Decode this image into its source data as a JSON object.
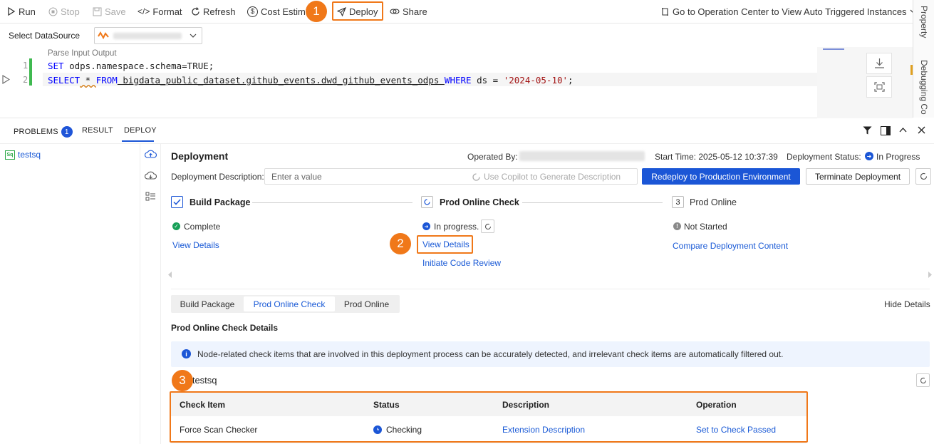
{
  "toolbar": {
    "run": "Run",
    "stop": "Stop",
    "save": "Save",
    "format": "Format",
    "refresh": "Refresh",
    "cost": "Cost Estima",
    "deploy": "Deploy",
    "share": "Share",
    "operation_center": "Go to Operation Center to View Auto Triggered Instances"
  },
  "callouts": {
    "one": "1",
    "two": "2",
    "three": "3"
  },
  "right_strip": {
    "property": "Property",
    "debugging": "Debugging Co"
  },
  "datasource": {
    "label": "Select DataSource"
  },
  "editor": {
    "hint": "Parse Input Output",
    "line_numbers": [
      "1",
      "2"
    ],
    "line1": {
      "kw1": "SET",
      "text": " odps.namespace.schema=TRUE;"
    },
    "line2": {
      "kw_select": "SELECT",
      "star": " * ",
      "kw_from": "FROM",
      "table": " bigdata_public_dataset.github_events.dwd_github_events_odps ",
      "kw_where": "WHERE",
      "cond": " ds = ",
      "value": "'2024-05-10'",
      "end": ";"
    }
  },
  "panel": {
    "tabs": {
      "problems": "PROBLEMS",
      "problems_count": "1",
      "result": "RESULT",
      "deploy": "DEPLOY"
    },
    "tree_item": "testsq",
    "tree_item_icon": "Sq"
  },
  "deployment": {
    "title": "Deployment",
    "operated_by_label": "Operated By:",
    "start_time_label": "Start Time:",
    "start_time": "2025-05-12 10:37:39",
    "status_label": "Deployment Status:",
    "status": "In Progress",
    "description_label": "Deployment Description:",
    "description_placeholder": "Enter a value",
    "copilot": "Use Copilot to Generate Description",
    "redeploy": "Redeploy to Production Environment",
    "terminate": "Terminate Deployment"
  },
  "steps": [
    {
      "name": "Build Package",
      "status": "Complete",
      "link1": "View Details"
    },
    {
      "name": "Prod Online Check",
      "status": "In progress.",
      "link1": "View Details",
      "link2": "Initiate Code Review"
    },
    {
      "name": "Prod Online",
      "index": "3",
      "status": "Not Started",
      "link1": "Compare Deployment Content"
    }
  ],
  "details": {
    "segments": [
      "Build Package",
      "Prod Online Check",
      "Prod Online"
    ],
    "active_segment": "Prod Online Check",
    "hide": "Hide Details",
    "heading": "Prod Online Check Details",
    "info": "Node-related check items that are involved in this deployment process can be accurately detected, and irrelevant check items are automatically filtered out.",
    "node": "e:testsq"
  },
  "table": {
    "headers": [
      "Check Item",
      "Status",
      "Description",
      "Operation"
    ],
    "rows": [
      [
        "Force Scan Checker",
        "Checking",
        "Extension Description",
        "Set to Check Passed"
      ]
    ]
  },
  "colors": {
    "accent": "#1b56d6",
    "callout": "#f07819",
    "success": "#18a058"
  }
}
